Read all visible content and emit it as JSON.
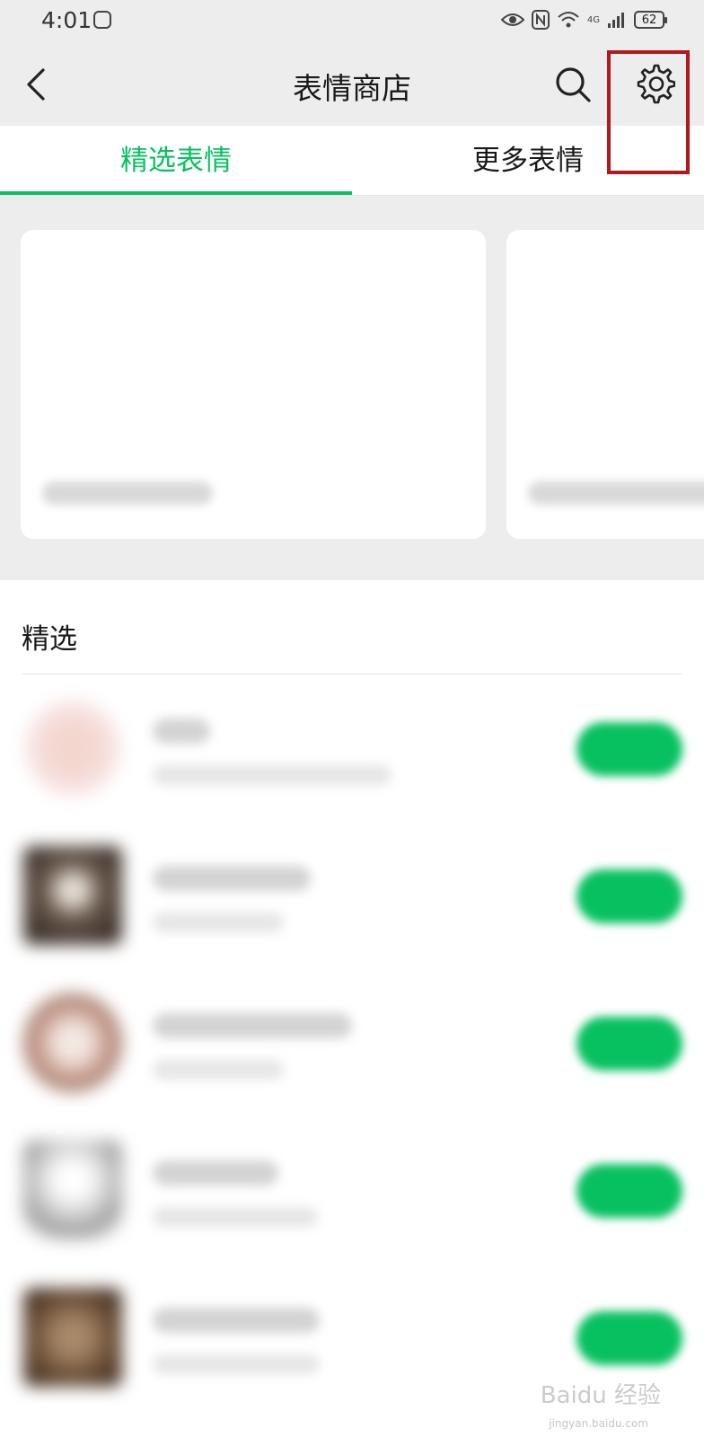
{
  "status_bar": {
    "time": "4:01",
    "network": "4G",
    "battery": "62"
  },
  "nav": {
    "title": "表情商店"
  },
  "tabs": [
    {
      "label": "精选表情",
      "active": true
    },
    {
      "label": "更多表情",
      "active": false
    }
  ],
  "section": {
    "title": "精选"
  },
  "colors": {
    "accent": "#07c160",
    "highlight": "#b0191e",
    "background": "#ededed"
  },
  "icons": {
    "back": "chevron-left-icon",
    "search": "search-icon",
    "settings": "gear-icon"
  },
  "watermark": {
    "text": "Baidu 经验",
    "sub": "jingyan.baidu.com"
  }
}
